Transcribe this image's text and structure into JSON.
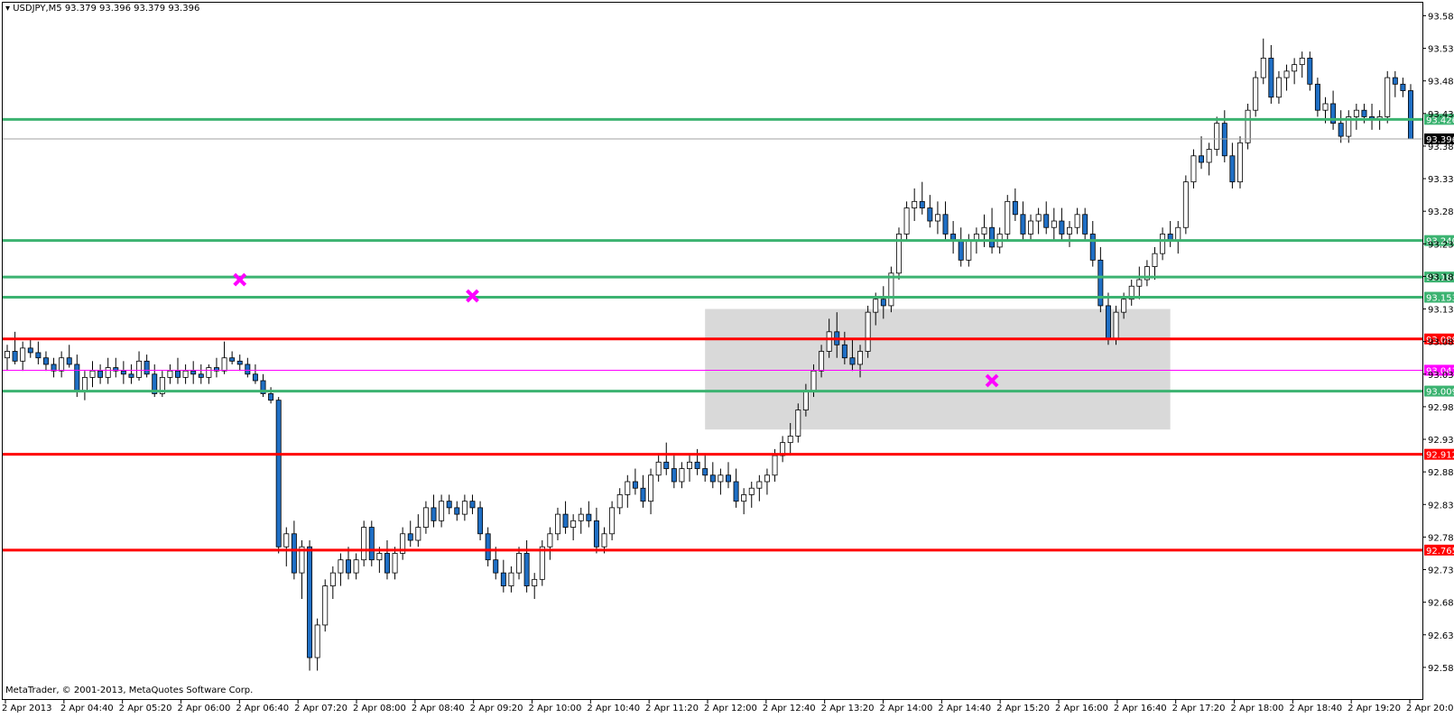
{
  "header": {
    "symbol": "USDJPY,M5",
    "ohlc": "93.379 93.396 93.379 93.396"
  },
  "footer": {
    "copyright": "MetaTrader, © 2001-2013, MetaQuotes Software Corp."
  },
  "colors": {
    "background": "#ffffff",
    "bull_body": "#ffffff",
    "bear_body": "#1f6fc5",
    "wick": "#000000",
    "support_line": "#3cb371",
    "resistance_line": "#ff0000",
    "pivot_line": "#ff00ff",
    "zone_fill": "#d9d9d9",
    "marker": "#ff00ff"
  },
  "chart_data": {
    "type": "candlestick",
    "symbol": "USDJPY",
    "timeframe": "M5",
    "ylim": [
      92.535,
      93.605
    ],
    "y_ticks": [
      "93.585",
      "93.535",
      "93.485",
      "93.435",
      "93.385",
      "93.335",
      "93.285",
      "93.235",
      "93.185",
      "93.135",
      "93.085",
      "93.035",
      "92.985",
      "92.935",
      "92.885",
      "92.835",
      "92.785",
      "92.735",
      "92.685",
      "92.635",
      "92.585"
    ],
    "x_ticks": [
      "2 Apr 2013",
      "2 Apr 04:40",
      "2 Apr 05:20",
      "2 Apr 06:00",
      "2 Apr 06:40",
      "2 Apr 07:20",
      "2 Apr 08:00",
      "2 Apr 08:40",
      "2 Apr 09:20",
      "2 Apr 10:00",
      "2 Apr 10:40",
      "2 Apr 11:20",
      "2 Apr 12:00",
      "2 Apr 12:40",
      "2 Apr 13:20",
      "2 Apr 14:00",
      "2 Apr 14:40",
      "2 Apr 15:20",
      "2 Apr 16:00",
      "2 Apr 16:40",
      "2 Apr 17:20",
      "2 Apr 18:00",
      "2 Apr 18:40",
      "2 Apr 19:20",
      "2 Apr 20:00"
    ],
    "current_price": "93.396",
    "horizontal_lines": [
      {
        "price": 93.426,
        "label": "93.426",
        "color": "#3cb371"
      },
      {
        "price": 93.24,
        "label": "93.240",
        "color": "#3cb371"
      },
      {
        "price": 93.184,
        "label": "93.184",
        "color": "#3cb371"
      },
      {
        "price": 93.153,
        "label": "93.153",
        "color": "#3cb371"
      },
      {
        "price": 93.089,
        "label": "93.089",
        "color": "#ff0000"
      },
      {
        "price": 93.041,
        "label": "93.041",
        "color": "#ff00ff"
      },
      {
        "price": 93.009,
        "label": "93.009",
        "color": "#3cb371"
      },
      {
        "price": 92.912,
        "label": "92.912",
        "color": "#ff0000"
      },
      {
        "price": 92.765,
        "label": "92.765",
        "color": "#ff0000"
      }
    ],
    "zone": {
      "from_bar": 90,
      "to_bar": 150,
      "high": 93.135,
      "low": 92.95
    },
    "markers": [
      {
        "bar": 30,
        "price": 93.18
      },
      {
        "bar": 60,
        "price": 93.155
      },
      {
        "bar": 127,
        "price": 93.025
      }
    ],
    "candles": [
      [
        93.06,
        93.08,
        93.04,
        93.07
      ],
      [
        93.07,
        93.1,
        93.05,
        93.055
      ],
      [
        93.055,
        93.085,
        93.04,
        93.075
      ],
      [
        93.075,
        93.09,
        93.06,
        93.068
      ],
      [
        93.068,
        93.085,
        93.05,
        93.06
      ],
      [
        93.06,
        93.07,
        93.04,
        93.05
      ],
      [
        93.05,
        93.06,
        93.03,
        93.04
      ],
      [
        93.04,
        93.07,
        93.03,
        93.06
      ],
      [
        93.06,
        93.08,
        93.045,
        93.05
      ],
      [
        93.05,
        93.065,
        93.0,
        93.01
      ],
      [
        93.01,
        93.04,
        92.995,
        93.03
      ],
      [
        93.03,
        93.055,
        93.015,
        93.04
      ],
      [
        93.04,
        93.05,
        93.02,
        93.03
      ],
      [
        93.03,
        93.06,
        93.02,
        93.045
      ],
      [
        93.045,
        93.06,
        93.03,
        93.04
      ],
      [
        93.04,
        93.055,
        93.02,
        93.035
      ],
      [
        93.035,
        93.05,
        93.02,
        93.03
      ],
      [
        93.03,
        93.07,
        93.025,
        93.055
      ],
      [
        93.055,
        93.065,
        93.03,
        93.035
      ],
      [
        93.035,
        93.05,
        93.0,
        93.005
      ],
      [
        93.005,
        93.04,
        93.0,
        93.03
      ],
      [
        93.03,
        93.05,
        93.02,
        93.04
      ],
      [
        93.04,
        93.06,
        93.02,
        93.03
      ],
      [
        93.03,
        93.05,
        93.02,
        93.04
      ],
      [
        93.04,
        93.055,
        93.02,
        93.035
      ],
      [
        93.035,
        93.05,
        93.02,
        93.03
      ],
      [
        93.03,
        93.05,
        93.02,
        93.045
      ],
      [
        93.045,
        93.06,
        93.03,
        93.04
      ],
      [
        93.04,
        93.085,
        93.035,
        93.06
      ],
      [
        93.06,
        93.07,
        93.05,
        93.055
      ],
      [
        93.055,
        93.065,
        93.04,
        93.05
      ],
      [
        93.05,
        93.06,
        93.03,
        93.035
      ],
      [
        93.035,
        93.05,
        93.02,
        93.025
      ],
      [
        93.025,
        93.035,
        93.0,
        93.005
      ],
      [
        93.005,
        93.015,
        92.99,
        92.995
      ],
      [
        92.995,
        93.0,
        92.76,
        92.77
      ],
      [
        92.77,
        92.8,
        92.74,
        92.79
      ],
      [
        92.79,
        92.81,
        92.72,
        92.73
      ],
      [
        92.73,
        92.78,
        92.69,
        92.77
      ],
      [
        92.77,
        92.78,
        92.58,
        92.6
      ],
      [
        92.6,
        92.66,
        92.58,
        92.65
      ],
      [
        92.65,
        92.72,
        92.64,
        92.71
      ],
      [
        92.71,
        92.74,
        92.69,
        92.73
      ],
      [
        92.73,
        92.76,
        92.71,
        92.75
      ],
      [
        92.75,
        92.77,
        92.72,
        92.73
      ],
      [
        92.73,
        92.76,
        92.72,
        92.75
      ],
      [
        92.75,
        92.81,
        92.74,
        92.8
      ],
      [
        92.8,
        92.81,
        92.74,
        92.75
      ],
      [
        92.75,
        92.77,
        92.73,
        92.76
      ],
      [
        92.76,
        92.78,
        92.72,
        92.73
      ],
      [
        92.73,
        92.77,
        92.72,
        92.76
      ],
      [
        92.76,
        92.8,
        92.75,
        92.79
      ],
      [
        92.79,
        92.81,
        92.77,
        92.78
      ],
      [
        92.78,
        92.82,
        92.77,
        92.8
      ],
      [
        92.8,
        92.84,
        92.79,
        92.83
      ],
      [
        92.83,
        92.85,
        92.8,
        92.81
      ],
      [
        92.81,
        92.85,
        92.8,
        92.84
      ],
      [
        92.84,
        92.85,
        92.82,
        92.83
      ],
      [
        92.83,
        92.84,
        92.81,
        92.82
      ],
      [
        92.82,
        92.85,
        92.81,
        92.84
      ],
      [
        92.84,
        92.85,
        92.82,
        92.83
      ],
      [
        92.83,
        92.84,
        92.78,
        92.79
      ],
      [
        92.79,
        92.8,
        92.74,
        92.75
      ],
      [
        92.75,
        92.77,
        92.72,
        92.73
      ],
      [
        92.73,
        92.75,
        92.7,
        92.71
      ],
      [
        92.71,
        92.74,
        92.7,
        92.73
      ],
      [
        92.73,
        92.77,
        92.72,
        92.76
      ],
      [
        92.76,
        92.78,
        92.7,
        92.71
      ],
      [
        92.71,
        92.73,
        92.69,
        92.72
      ],
      [
        92.72,
        92.78,
        92.71,
        92.77
      ],
      [
        92.77,
        92.8,
        92.75,
        92.79
      ],
      [
        92.79,
        92.83,
        92.78,
        92.82
      ],
      [
        92.82,
        92.84,
        92.79,
        92.8
      ],
      [
        92.8,
        92.82,
        92.78,
        92.81
      ],
      [
        92.81,
        92.83,
        92.79,
        92.82
      ],
      [
        92.82,
        92.84,
        92.8,
        92.81
      ],
      [
        92.81,
        92.83,
        92.76,
        92.77
      ],
      [
        92.77,
        92.8,
        92.76,
        92.79
      ],
      [
        92.79,
        92.84,
        92.78,
        92.83
      ],
      [
        92.83,
        92.86,
        92.82,
        92.85
      ],
      [
        92.85,
        92.88,
        92.83,
        92.87
      ],
      [
        92.87,
        92.89,
        92.85,
        92.86
      ],
      [
        92.86,
        92.88,
        92.83,
        92.84
      ],
      [
        92.84,
        92.89,
        92.82,
        92.88
      ],
      [
        92.88,
        92.91,
        92.87,
        92.9
      ],
      [
        92.9,
        92.93,
        92.88,
        92.89
      ],
      [
        92.89,
        92.91,
        92.86,
        92.87
      ],
      [
        92.87,
        92.9,
        92.86,
        92.89
      ],
      [
        92.89,
        92.91,
        92.87,
        92.9
      ],
      [
        92.9,
        92.92,
        92.88,
        92.89
      ],
      [
        92.89,
        92.91,
        92.87,
        92.88
      ],
      [
        92.88,
        92.9,
        92.86,
        92.87
      ],
      [
        92.87,
        92.89,
        92.85,
        92.88
      ],
      [
        92.88,
        92.9,
        92.86,
        92.87
      ],
      [
        92.87,
        92.89,
        92.83,
        92.84
      ],
      [
        92.84,
        92.86,
        92.82,
        92.85
      ],
      [
        92.85,
        92.87,
        92.83,
        92.86
      ],
      [
        92.86,
        92.88,
        92.84,
        92.87
      ],
      [
        92.87,
        92.89,
        92.85,
        92.88
      ],
      [
        92.88,
        92.92,
        92.87,
        92.91
      ],
      [
        92.91,
        92.94,
        92.9,
        92.93
      ],
      [
        92.93,
        92.96,
        92.91,
        92.94
      ],
      [
        92.94,
        92.99,
        92.93,
        92.98
      ],
      [
        92.98,
        93.02,
        92.97,
        93.01
      ],
      [
        93.01,
        93.05,
        93.0,
        93.04
      ],
      [
        93.04,
        93.08,
        93.03,
        93.07
      ],
      [
        93.07,
        93.12,
        93.06,
        93.1
      ],
      [
        93.1,
        93.13,
        93.06,
        93.08
      ],
      [
        93.08,
        93.1,
        93.05,
        93.06
      ],
      [
        93.06,
        93.09,
        93.04,
        93.05
      ],
      [
        93.05,
        93.08,
        93.03,
        93.07
      ],
      [
        93.07,
        93.14,
        93.06,
        93.13
      ],
      [
        93.13,
        93.16,
        93.11,
        93.15
      ],
      [
        93.15,
        93.17,
        93.12,
        93.14
      ],
      [
        93.14,
        93.2,
        93.13,
        93.19
      ],
      [
        93.19,
        93.26,
        93.18,
        93.25
      ],
      [
        93.25,
        93.3,
        93.24,
        93.29
      ],
      [
        93.29,
        93.32,
        93.27,
        93.3
      ],
      [
        93.3,
        93.33,
        93.28,
        93.29
      ],
      [
        93.29,
        93.31,
        93.26,
        93.27
      ],
      [
        93.27,
        93.3,
        93.25,
        93.28
      ],
      [
        93.28,
        93.3,
        93.24,
        93.25
      ],
      [
        93.25,
        93.27,
        93.22,
        93.24
      ],
      [
        93.24,
        93.26,
        93.2,
        93.21
      ],
      [
        93.21,
        93.25,
        93.2,
        93.24
      ],
      [
        93.24,
        93.26,
        93.22,
        93.25
      ],
      [
        93.25,
        93.28,
        93.23,
        93.26
      ],
      [
        93.26,
        93.29,
        93.22,
        93.23
      ],
      [
        93.23,
        93.26,
        93.22,
        93.25
      ],
      [
        93.25,
        93.31,
        93.24,
        93.3
      ],
      [
        93.3,
        93.32,
        93.27,
        93.28
      ],
      [
        93.28,
        93.3,
        93.24,
        93.25
      ],
      [
        93.25,
        93.28,
        93.24,
        93.27
      ],
      [
        93.27,
        93.29,
        93.25,
        93.28
      ],
      [
        93.28,
        93.3,
        93.25,
        93.26
      ],
      [
        93.26,
        93.29,
        93.24,
        93.27
      ],
      [
        93.27,
        93.29,
        93.24,
        93.25
      ],
      [
        93.25,
        93.27,
        93.23,
        93.26
      ],
      [
        93.26,
        93.29,
        93.25,
        93.28
      ],
      [
        93.28,
        93.29,
        93.24,
        93.25
      ],
      [
        93.25,
        93.27,
        93.2,
        93.21
      ],
      [
        93.21,
        93.23,
        93.13,
        93.14
      ],
      [
        93.14,
        93.16,
        93.08,
        93.09
      ],
      [
        93.09,
        93.14,
        93.08,
        93.13
      ],
      [
        93.13,
        93.16,
        93.12,
        93.15
      ],
      [
        93.15,
        93.18,
        93.14,
        93.17
      ],
      [
        93.17,
        93.2,
        93.15,
        93.18
      ],
      [
        93.18,
        93.21,
        93.17,
        93.2
      ],
      [
        93.2,
        93.23,
        93.18,
        93.22
      ],
      [
        93.22,
        93.26,
        93.21,
        93.25
      ],
      [
        93.25,
        93.27,
        93.23,
        93.24
      ],
      [
        93.24,
        93.27,
        93.22,
        93.26
      ],
      [
        93.26,
        93.34,
        93.25,
        93.33
      ],
      [
        93.33,
        93.38,
        93.32,
        93.37
      ],
      [
        93.37,
        93.4,
        93.35,
        93.36
      ],
      [
        93.36,
        93.39,
        93.34,
        93.38
      ],
      [
        93.38,
        93.43,
        93.37,
        93.42
      ],
      [
        93.42,
        93.44,
        93.36,
        93.37
      ],
      [
        93.37,
        93.39,
        93.32,
        93.33
      ],
      [
        93.33,
        93.4,
        93.32,
        93.39
      ],
      [
        93.39,
        93.45,
        93.38,
        93.44
      ],
      [
        93.44,
        93.5,
        93.43,
        93.49
      ],
      [
        93.49,
        93.55,
        93.48,
        93.52
      ],
      [
        93.52,
        93.54,
        93.45,
        93.46
      ],
      [
        93.46,
        93.5,
        93.45,
        93.49
      ],
      [
        93.49,
        93.51,
        93.47,
        93.5
      ],
      [
        93.5,
        93.52,
        93.48,
        93.51
      ],
      [
        93.51,
        93.53,
        93.49,
        93.52
      ],
      [
        93.52,
        93.53,
        93.47,
        93.48
      ],
      [
        93.48,
        93.49,
        93.43,
        93.44
      ],
      [
        93.44,
        93.46,
        93.42,
        93.45
      ],
      [
        93.45,
        93.47,
        93.41,
        93.42
      ],
      [
        93.42,
        93.44,
        93.39,
        93.4
      ],
      [
        93.4,
        93.44,
        93.39,
        93.43
      ],
      [
        93.43,
        93.45,
        93.41,
        93.44
      ],
      [
        93.44,
        93.45,
        93.42,
        93.43
      ],
      [
        93.43,
        93.45,
        93.41,
        93.425
      ],
      [
        93.425,
        93.44,
        93.41,
        93.43
      ],
      [
        93.43,
        93.5,
        93.42,
        93.49
      ],
      [
        93.49,
        93.5,
        93.46,
        93.48
      ],
      [
        93.48,
        93.49,
        93.46,
        93.47
      ],
      [
        93.47,
        93.48,
        93.4,
        93.396
      ]
    ]
  }
}
